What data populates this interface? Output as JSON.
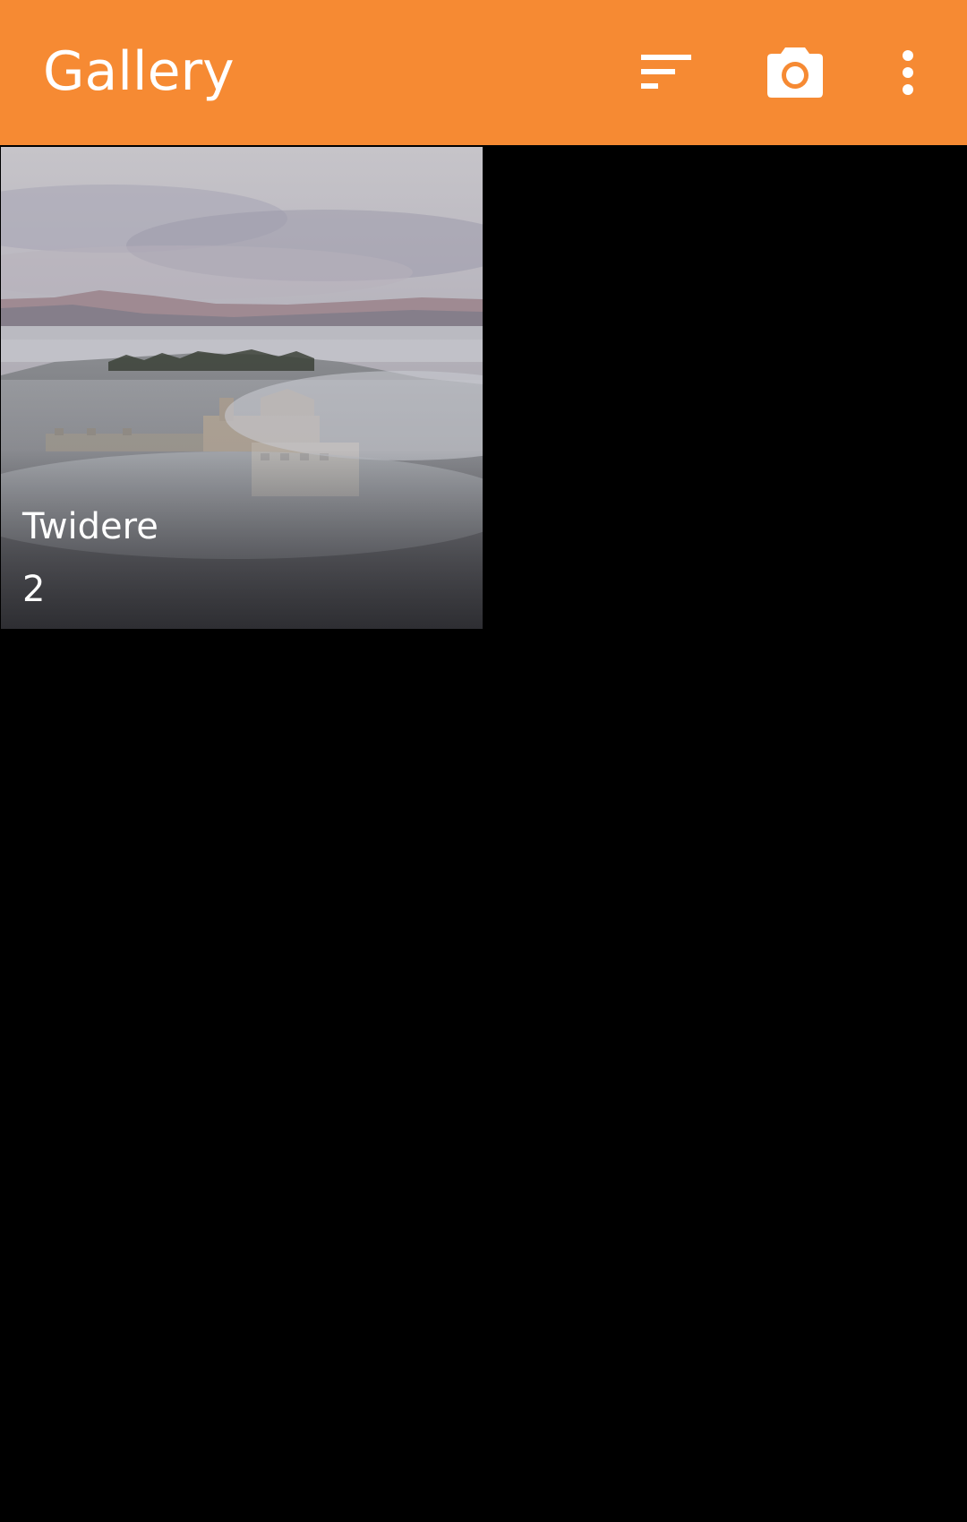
{
  "app_bar": {
    "title": "Gallery",
    "background_color": "#f68a33",
    "actions": [
      {
        "name": "sort",
        "icon": "sort-icon"
      },
      {
        "name": "camera",
        "icon": "camera-icon"
      },
      {
        "name": "more",
        "icon": "more-vert-icon"
      }
    ]
  },
  "albums": [
    {
      "name": "Twidere",
      "count": "2",
      "thumbnail": "foggy-hilltop-village-landscape"
    }
  ]
}
